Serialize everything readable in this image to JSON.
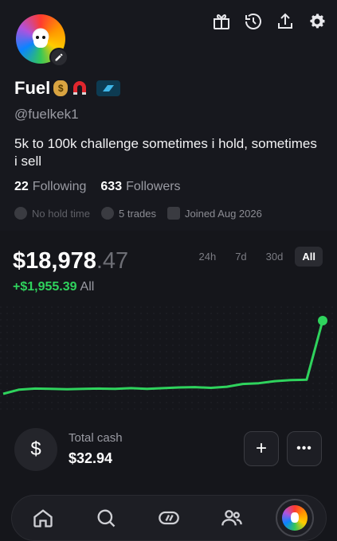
{
  "profile": {
    "name": "Fuel",
    "handle": "@fuelkek1",
    "bio": "5k to 100k challenge sometimes i hold, sometimes i sell",
    "following_count": "22",
    "following_label": "Following",
    "followers_count": "633",
    "followers_label": "Followers",
    "hold_time": "No hold time",
    "trades": "5 trades",
    "joined": "Joined Aug 2026"
  },
  "portfolio": {
    "balance_main": "$18,978",
    "balance_cents": ".47",
    "pnl": "+$1,955.39",
    "pnl_period": "All",
    "ranges": [
      "24h",
      "7d",
      "30d",
      "All"
    ],
    "active_range": "All"
  },
  "cash": {
    "symbol": "$",
    "label": "Total cash",
    "value": "$32.94",
    "add_label": "+",
    "more_label": "•••"
  },
  "colors": {
    "gain": "#2fd35d",
    "background": "#15161b"
  },
  "chart_data": {
    "type": "line",
    "x": [
      0,
      1,
      2,
      3,
      4,
      5,
      6,
      7,
      8,
      9,
      10,
      11,
      12,
      13,
      14,
      15,
      16,
      17,
      18,
      19,
      20
    ],
    "values": [
      16900,
      17020,
      17050,
      17040,
      17030,
      17040,
      17050,
      17040,
      17060,
      17040,
      17060,
      17080,
      17090,
      17070,
      17100,
      17180,
      17200,
      17260,
      17290,
      17300,
      18978
    ],
    "title": "",
    "xlabel": "",
    "ylabel": ""
  },
  "icons": {
    "top": [
      "gift-icon",
      "history-icon",
      "share-icon",
      "settings-icon"
    ],
    "nav": [
      "home-icon",
      "search-icon",
      "trade-icon",
      "people-icon",
      "profile-avatar"
    ]
  }
}
